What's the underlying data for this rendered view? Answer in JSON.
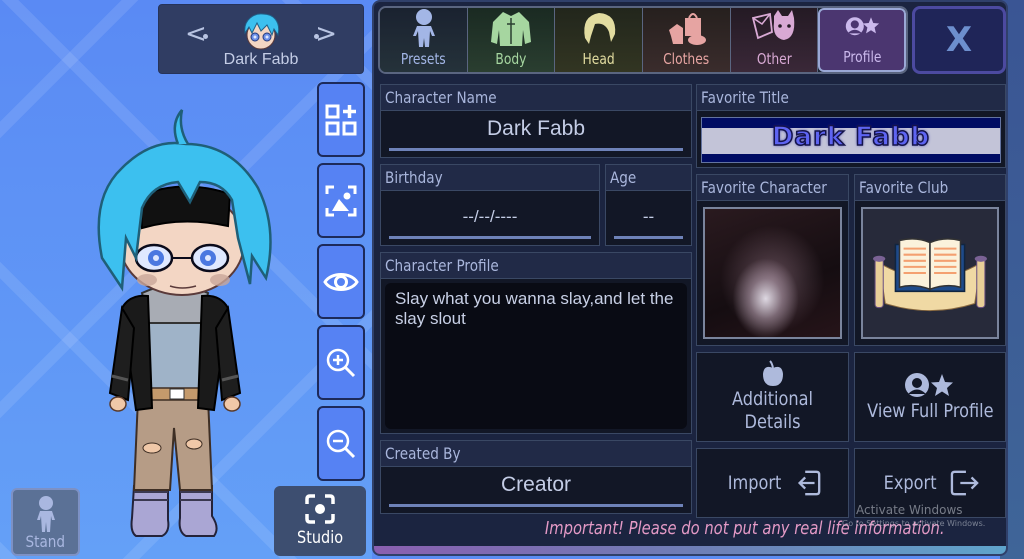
{
  "app": {
    "name": "Gacha Life 2 - Profile Editor"
  },
  "character_selector": {
    "name": "Dark Fabb",
    "prev_icon": "chevron-left-icon",
    "next_icon": "chevron-right-icon"
  },
  "side_tools": [
    {
      "id": "add-preset",
      "icon": "grid-plus-icon"
    },
    {
      "id": "background",
      "icon": "image-frame-icon"
    },
    {
      "id": "visibility",
      "icon": "eye-icon"
    },
    {
      "id": "zoom-in",
      "icon": "zoom-in-icon"
    },
    {
      "id": "zoom-out",
      "icon": "zoom-out-icon"
    }
  ],
  "stand_button": {
    "label": "Stand"
  },
  "studio_button": {
    "label": "Studio"
  },
  "tabs": [
    {
      "label": "Presets",
      "color": "#a3b6e6",
      "active": false
    },
    {
      "label": "Body",
      "color": "#a6d6a0",
      "active": false
    },
    {
      "label": "Head",
      "color": "#e2dca0",
      "active": false
    },
    {
      "label": "Clothes",
      "color": "#e6a4a2",
      "active": false
    },
    {
      "label": "Other",
      "color": "#d8a9d4",
      "active": false
    },
    {
      "label": "Profile",
      "color": "#cbb9ec",
      "active": true
    }
  ],
  "close_button": {
    "label": "X"
  },
  "profile": {
    "character_name": {
      "label": "Character Name",
      "value": "Dark Fabb"
    },
    "birthday": {
      "label": "Birthday",
      "value": "--/--/----"
    },
    "age": {
      "label": "Age",
      "value": "--"
    },
    "character_profile": {
      "label": "Character Profile",
      "value": "Slay what you wanna slay,and let the slay slout"
    },
    "created_by": {
      "label": "Created By",
      "value": "Creator"
    },
    "favorite_title": {
      "label": "Favorite Title",
      "value": "Dark Fabb"
    },
    "favorite_character": {
      "label": "Favorite Character"
    },
    "favorite_club": {
      "label": "Favorite Club"
    }
  },
  "actions": {
    "additional_details": "Additional Details",
    "view_full_profile": "View Full Profile",
    "import": "Import",
    "export": "Export"
  },
  "warning": "Important! Please do not put any real life information.",
  "watermark": {
    "line1": "Activate Windows",
    "line2": "Go to Settings to activate Windows."
  }
}
